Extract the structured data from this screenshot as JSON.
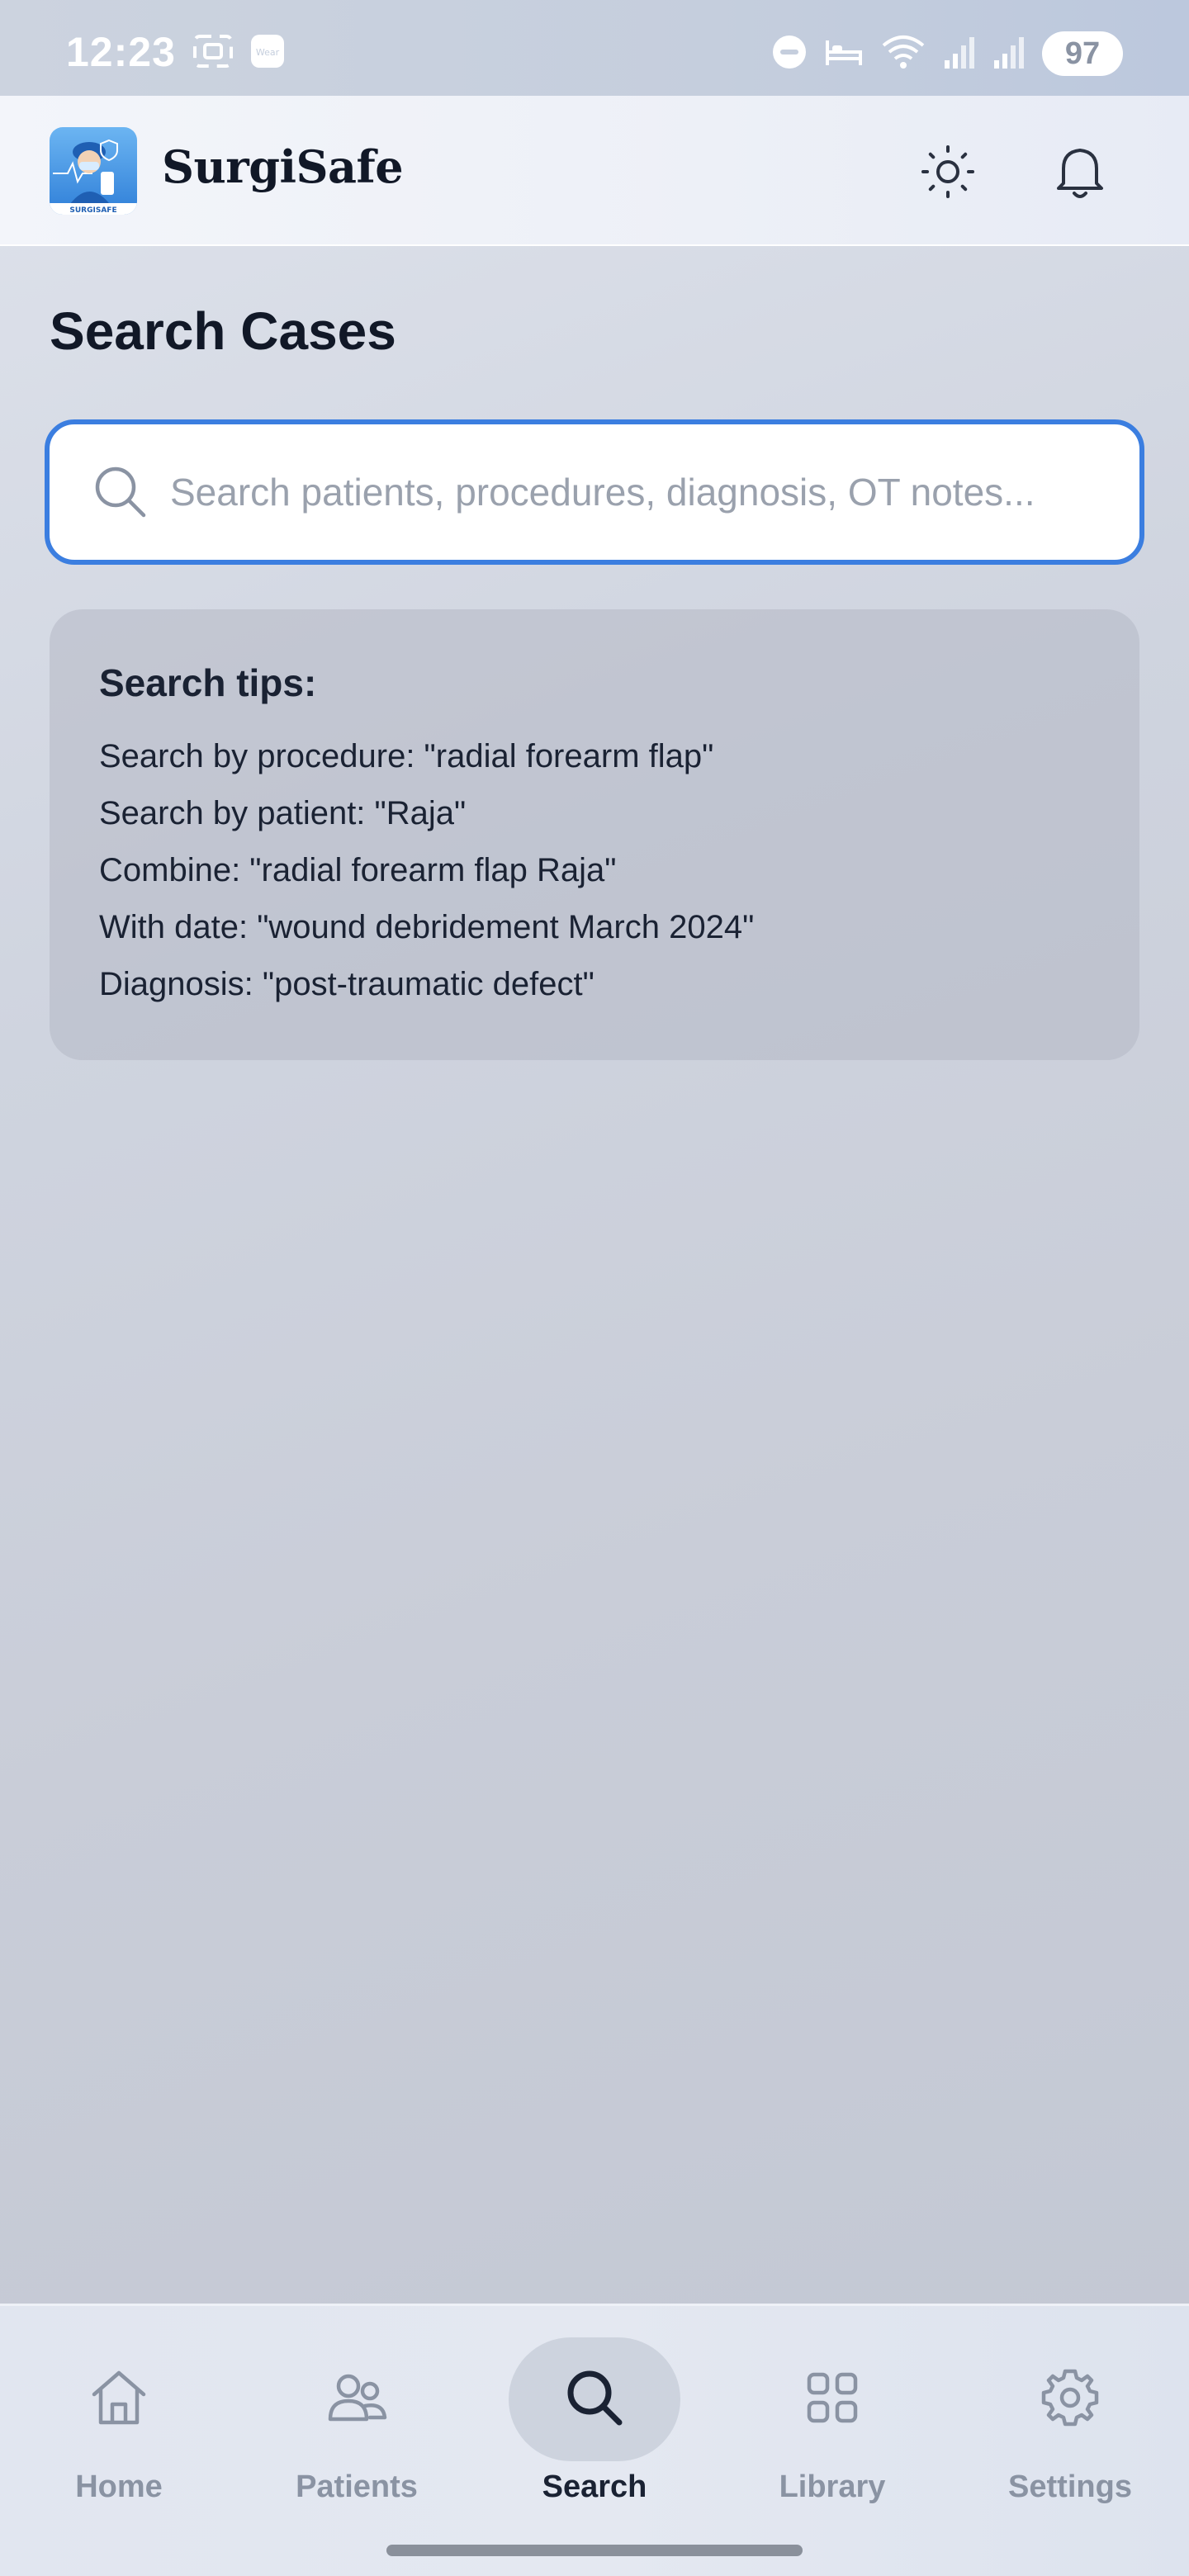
{
  "status_bar": {
    "time": "12:23",
    "battery": "97",
    "left_icons": [
      "screenshot-icon",
      "wear-icon"
    ],
    "right_icons": [
      "do-not-disturb-icon",
      "bed-icon",
      "wifi-icon",
      "signal-icon",
      "signal-icon"
    ]
  },
  "header": {
    "app_name": "SurgiSafe",
    "logo_text": "SURGISAFE",
    "icons": [
      "sun-icon",
      "bell-icon"
    ]
  },
  "main": {
    "title": "Search Cases",
    "search": {
      "placeholder": "Search patients, procedures, diagnosis, OT notes...",
      "value": ""
    },
    "tips": {
      "title": "Search tips:",
      "items": [
        "Search by procedure: \"radial forearm flap\"",
        "Search by patient: \"Raja\"",
        "Combine: \"radial forearm flap Raja\"",
        "With date: \"wound debridement March 2024\"",
        "Diagnosis: \"post-traumatic defect\""
      ]
    }
  },
  "bottom_nav": {
    "active": "Search",
    "items": [
      {
        "label": "Home",
        "icon": "home-icon"
      },
      {
        "label": "Patients",
        "icon": "users-icon"
      },
      {
        "label": "Search",
        "icon": "search-icon"
      },
      {
        "label": "Library",
        "icon": "grid-icon"
      },
      {
        "label": "Settings",
        "icon": "gear-icon"
      }
    ]
  },
  "colors": {
    "accent": "#3b7ee0",
    "text_primary": "#111827",
    "text_muted": "#8a93a3",
    "active_pill": "#cdd3de"
  }
}
